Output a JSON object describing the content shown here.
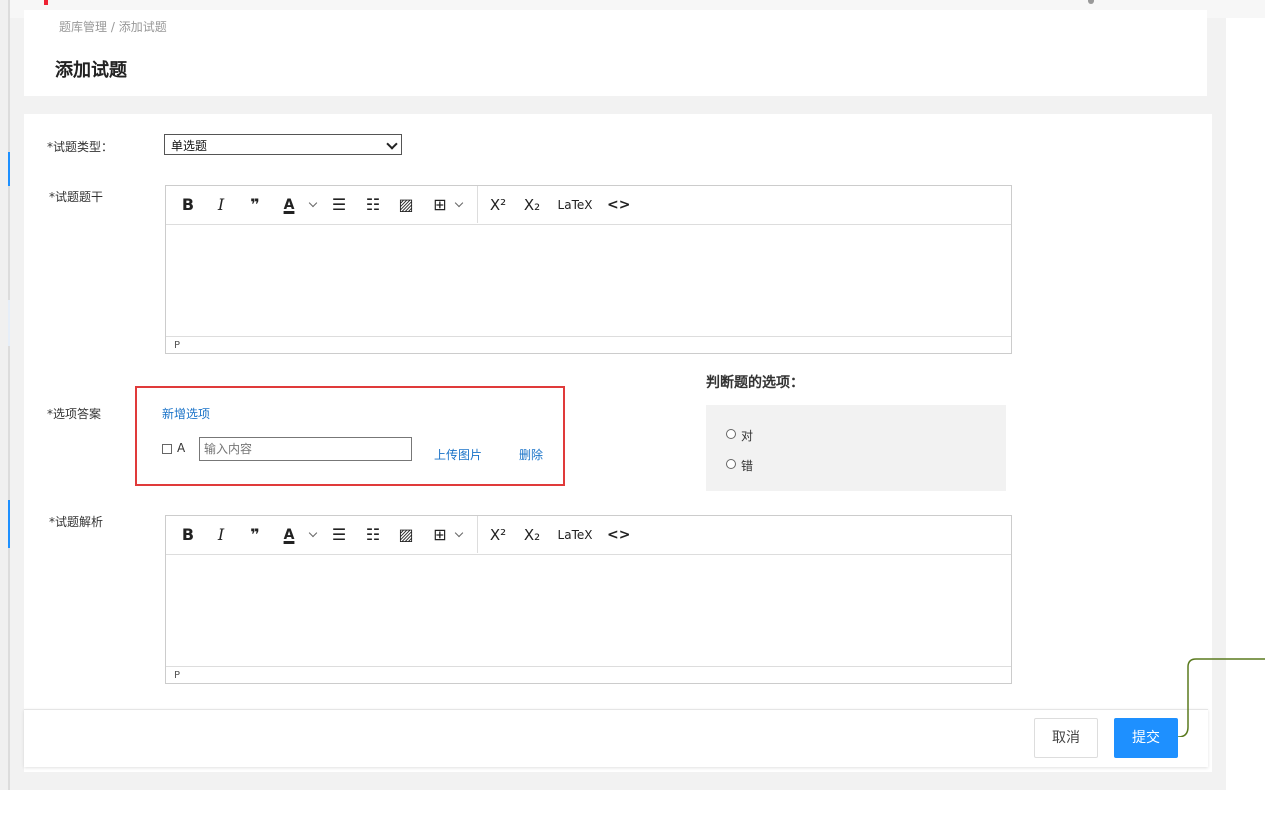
{
  "breadcrumb": {
    "parent": "题库管理",
    "sep": "/",
    "current": "添加试题"
  },
  "page": {
    "title": "添加试题"
  },
  "form": {
    "type_label": "*试题类型：",
    "type_selected": "单选题",
    "stem_label": "*试题题干",
    "options_label": "*选项答案",
    "analysis_label": "*试题解析"
  },
  "editor": {
    "toolbar": {
      "bold": "B",
      "italic": "I",
      "quote": "❞",
      "font_color": "A",
      "bullet_list": "☰",
      "ordered_list": "☷",
      "image": "▨",
      "table": "⊞",
      "superscript": "X²",
      "subscript": "X₂",
      "latex": "LaTeX",
      "code": "<>"
    },
    "status": "P"
  },
  "options": {
    "add_label": "新增选项",
    "items": [
      {
        "letter": "A",
        "placeholder": "输入内容",
        "upload_label": "上传图片",
        "delete_label": "删除"
      }
    ]
  },
  "judge": {
    "title": "判断题的选项：",
    "choices": [
      "对",
      "错"
    ]
  },
  "footer": {
    "cancel_label": "取消",
    "submit_label": "提交"
  },
  "colors": {
    "primary": "#1e90ff",
    "link": "#1a73c8",
    "highlight": "#e03a3a",
    "connector": "#5a7a1e"
  }
}
